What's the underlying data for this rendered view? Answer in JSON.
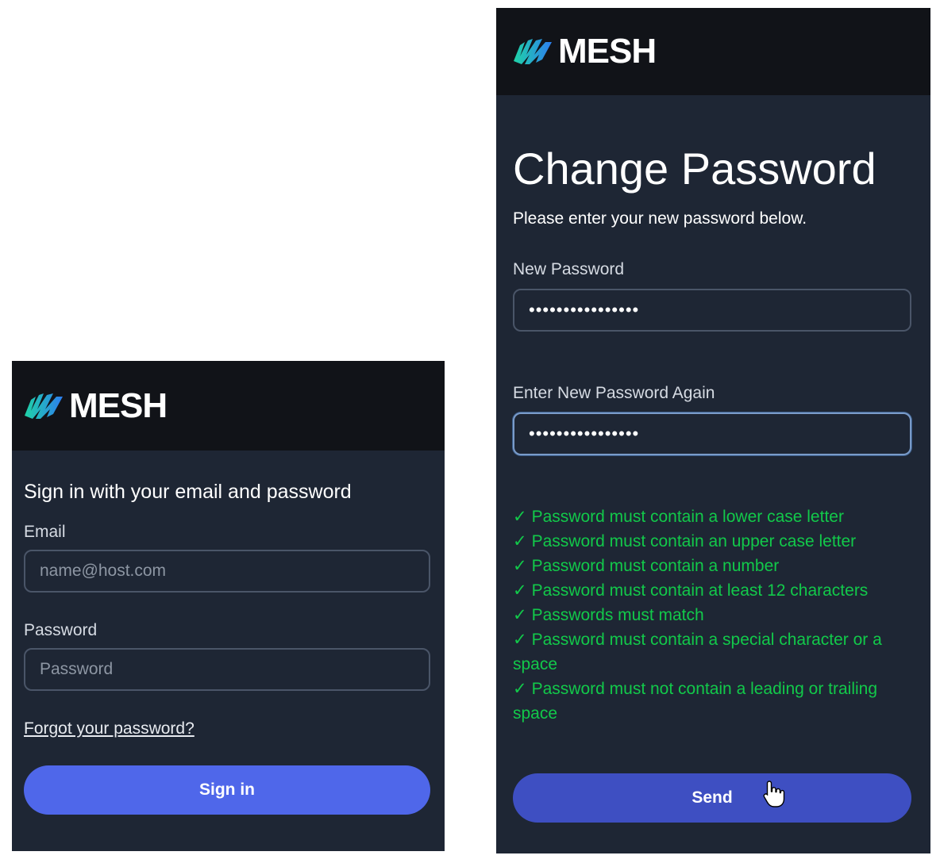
{
  "signin": {
    "logo_text": "MESH",
    "heading": "Sign in with your email and password",
    "email_label": "Email",
    "email_placeholder": "name@host.com",
    "password_label": "Password",
    "password_placeholder": "Password",
    "forgot_link": "Forgot your password?",
    "submit_label": "Sign in"
  },
  "change_password": {
    "logo_text": "MESH",
    "title": "Change Password",
    "subtitle": "Please enter your new password below.",
    "new_password_label": "New Password",
    "new_password_value": "••••••••••••••••",
    "confirm_label": "Enter New Password Again",
    "confirm_value": "••••••••••••••••",
    "check_mark": "✓",
    "requirements": [
      "Password must contain a lower case letter",
      "Password must contain an upper case letter",
      "Password must contain a number",
      "Password must contain at least 12 characters",
      "Passwords must match",
      "Password must contain a special character or a space",
      "Password must not contain a leading or trailing space"
    ],
    "submit_label": "Send"
  },
  "colors": {
    "panel_bg": "#1e2634",
    "header_bg": "#111318",
    "accent_signin": "#4f67ea",
    "accent_send": "#3e4fc2",
    "success": "#12c94a",
    "logo_gradient_start": "#1fd3a6",
    "logo_gradient_end": "#2d7ef0"
  },
  "icons": {
    "logo": "mesh-wave-logo-icon",
    "check": "check-icon",
    "cursor": "hand-pointer-cursor-icon"
  }
}
